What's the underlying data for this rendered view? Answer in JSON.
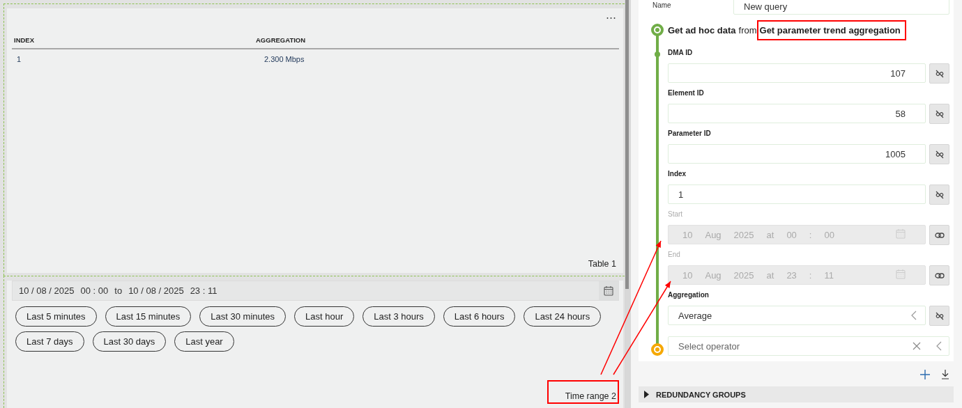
{
  "table_panel": {
    "menu": "⋯",
    "columns": [
      "INDEX",
      "AGGREGATION"
    ],
    "rows": [
      [
        "1",
        "2.300 Mbps"
      ]
    ],
    "caption": "Table 1"
  },
  "time_range_panel": {
    "start_date": "10 / 08 / 2025",
    "start_time": "00 : 00",
    "to": "to",
    "end_date": "10 / 08 / 2025",
    "end_time": "23 : 11",
    "presets": [
      [
        "Last 5 minutes",
        "Last 15 minutes",
        "Last 30 minutes",
        "Last hour",
        "Last 3 hours",
        "Last 6 hours",
        "Last 24 hours"
      ],
      [
        "Last 7 days",
        "Last 30 days",
        "Last year"
      ]
    ],
    "caption": "Time range 2",
    "caption_annotated": true
  },
  "query": {
    "name_label": "Name",
    "name_value": "New query",
    "heading": {
      "title": "Get ad hoc data",
      "from": "from",
      "source": "Get parameter trend aggregation",
      "source_annotated": true
    },
    "parameters": [
      {
        "label": "DMA ID",
        "kind": "number",
        "value": "107",
        "disabled": false,
        "linked": false
      },
      {
        "label": "Element ID",
        "kind": "number",
        "value": "58",
        "disabled": false,
        "linked": false
      },
      {
        "label": "Parameter ID",
        "kind": "number",
        "value": "1005",
        "disabled": false,
        "linked": false
      },
      {
        "label": "Index",
        "kind": "text",
        "value": "1",
        "disabled": false,
        "linked": false
      },
      {
        "label": "Start",
        "kind": "date",
        "parts": [
          "10",
          "Aug",
          "2025",
          "at",
          "00",
          ":",
          "00"
        ],
        "disabled": true,
        "linked": true
      },
      {
        "label": "End",
        "kind": "date",
        "parts": [
          "10",
          "Aug",
          "2025",
          "at",
          "23",
          ":",
          "11"
        ],
        "disabled": true,
        "linked": true
      },
      {
        "label": "Aggregation",
        "kind": "select",
        "value": "Average",
        "disabled": false,
        "linked": false
      }
    ],
    "operator": {
      "placeholder": "Select operator"
    },
    "section": {
      "title": "REDUNDANCY GROUPS",
      "expanded": false
    }
  }
}
